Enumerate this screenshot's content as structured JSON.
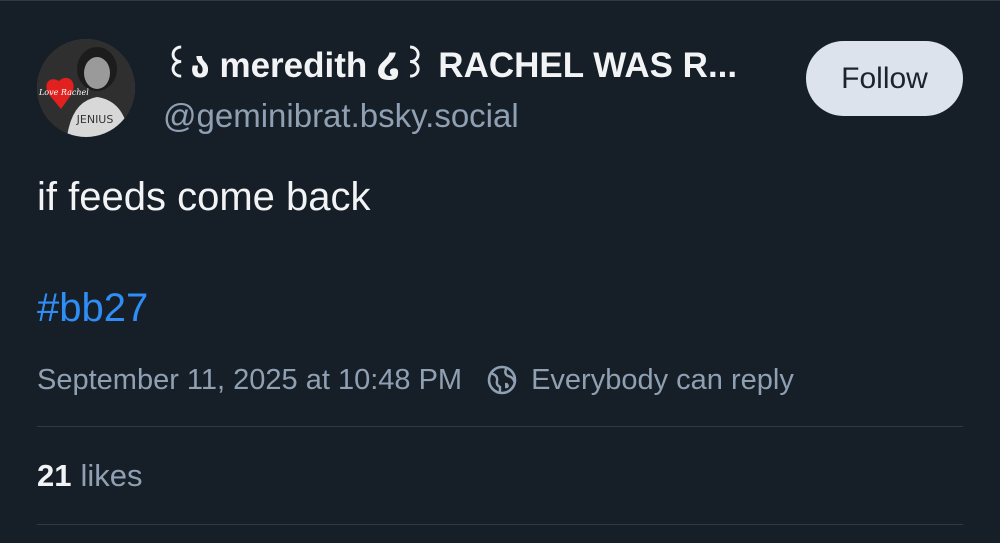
{
  "post": {
    "author": {
      "display_name": "꒰ა meredith ໒꒱ RACHEL WAS R...",
      "handle": "@geminibrat.bsky.social",
      "avatar_alt": "avatar",
      "avatar_sign_text": "I Love Rachel"
    },
    "follow_label": "Follow",
    "text": "if feeds come back",
    "hashtag": "#bb27",
    "timestamp": "September 11, 2025 at 10:48 PM",
    "reply_setting": "Everybody can reply",
    "reply_icon": "globe-icon",
    "likes": {
      "count": "21",
      "label": "likes"
    }
  },
  "colors": {
    "background": "#161e27",
    "text": "#f1f3f5",
    "muted": "#8fa0b3",
    "link": "#2f8df5",
    "follow_button_bg": "#dde3ec"
  }
}
